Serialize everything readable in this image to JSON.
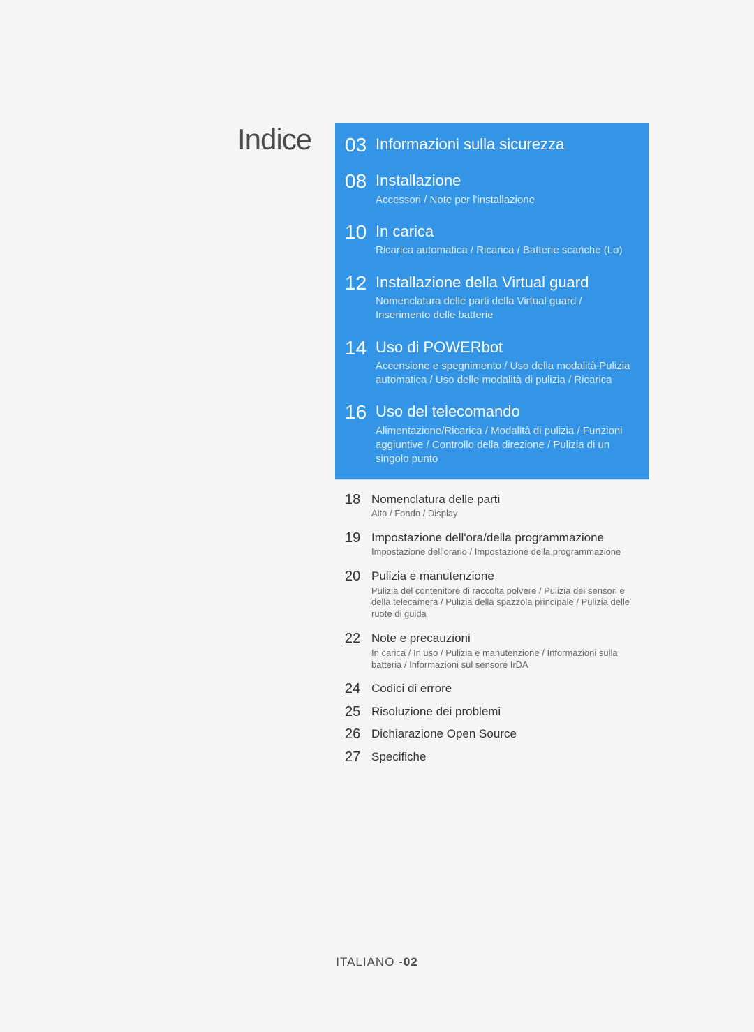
{
  "title": "Indice",
  "blue_entries": [
    {
      "page": "03",
      "title": "Informazioni sulla sicurezza",
      "sub": ""
    },
    {
      "page": "08",
      "title": "Installazione",
      "sub": "Accessori / Note per l'installazione"
    },
    {
      "page": "10",
      "title": "In carica",
      "sub": "Ricarica automatica / Ricarica / Batterie scariche (Lo)"
    },
    {
      "page": "12",
      "title": "Installazione della Virtual guard",
      "sub": "Nomenclatura delle parti della Virtual guard / Inserimento delle batterie"
    },
    {
      "page": "14",
      "title": "Uso di POWERbot",
      "sub": "Accensione e spegnimento / Uso della modalità Pulizia automatica / Uso delle modalità di pulizia / Ricarica"
    },
    {
      "page": "16",
      "title": "Uso del telecomando",
      "sub": "Alimentazione/Ricarica / Modalità di pulizia / Funzioni aggiuntive / Controllo della direzione / Pulizia di un singolo punto"
    }
  ],
  "white_entries": [
    {
      "page": "18",
      "title": "Nomenclatura delle parti",
      "sub": "Alto / Fondo / Display"
    },
    {
      "page": "19",
      "title": "Impostazione dell'ora/della programmazione",
      "sub": "Impostazione dell'orario / Impostazione della programmazione"
    },
    {
      "page": "20",
      "title": "Pulizia e manutenzione",
      "sub": "Pulizia del contenitore di raccolta polvere / Pulizia dei sensori e della telecamera / Pulizia della spazzola principale / Pulizia delle ruote di guida"
    },
    {
      "page": "22",
      "title": "Note e precauzioni",
      "sub": "In carica / In uso / Pulizia e manutenzione / Informazioni sulla batteria / Informazioni sul sensore IrDA"
    },
    {
      "page": "24",
      "title": "Codici di errore",
      "sub": ""
    },
    {
      "page": "25",
      "title": "Risoluzione dei problemi",
      "sub": ""
    },
    {
      "page": "26",
      "title": "Dichiarazione Open Source",
      "sub": ""
    },
    {
      "page": "27",
      "title": "Specifiche",
      "sub": ""
    }
  ],
  "footer": {
    "lang": "ITALIANO -",
    "page": "02"
  }
}
